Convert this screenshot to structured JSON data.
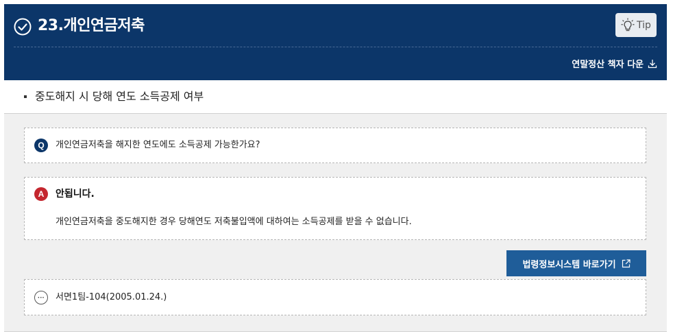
{
  "header": {
    "title": "23.개인연금저축",
    "tip_label": "Tip",
    "download_label": "연말정산 책자 다운"
  },
  "subtitle": "중도해지 시 당해 연도 소득공제 여부",
  "question": {
    "badge": "Q",
    "text": "개인연금저축을 해지한 연도에도 소득공제 가능한가요?"
  },
  "answer": {
    "badge": "A",
    "headline": "안됩니다.",
    "body": "개인연금저축을 중도해지한 경우 당해연도 저축불입액에 대하여는 소득공제를 받을 수 없습니다."
  },
  "law_button_label": "법령정보시스템 바로가기",
  "reference": {
    "badge": "···",
    "text": "서면1팀-104(2005.01.24.)"
  },
  "colors": {
    "header_bg": "#0c3669",
    "question_badge": "#0c3669",
    "answer_badge": "#c4262e",
    "law_button": "#1f5d99",
    "panel_bg": "#f0f0f0"
  },
  "icons": [
    "check-circle-icon",
    "lightbulb-icon",
    "download-icon",
    "external-link-icon",
    "more-icon"
  ]
}
